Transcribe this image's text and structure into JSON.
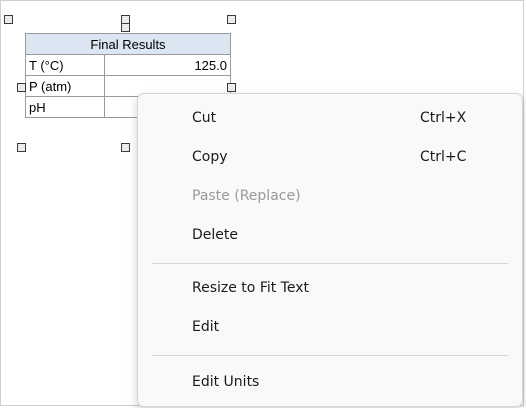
{
  "table": {
    "title": "Final Results",
    "rows": [
      {
        "label": "T (°C)",
        "value": "125.0"
      },
      {
        "label": "P (atm)",
        "value": ""
      },
      {
        "label": "pH",
        "value": ""
      }
    ]
  },
  "context_menu": {
    "items": [
      {
        "label": "Cut",
        "shortcut": "Ctrl+X",
        "enabled": true
      },
      {
        "label": "Copy",
        "shortcut": "Ctrl+C",
        "enabled": true
      },
      {
        "label": "Paste (Replace)",
        "shortcut": "",
        "enabled": false
      },
      {
        "label": "Delete",
        "shortcut": "",
        "enabled": true
      },
      {
        "label": "Resize to Fit Text",
        "shortcut": "",
        "enabled": true
      },
      {
        "label": "Edit",
        "shortcut": "",
        "enabled": true
      },
      {
        "label": "Edit Units",
        "shortcut": "",
        "enabled": true
      }
    ]
  },
  "colors": {
    "table_header_bg": "#dce6f2",
    "menu_bg": "#f9f9f9",
    "disabled_text": "#9a9a9a"
  }
}
